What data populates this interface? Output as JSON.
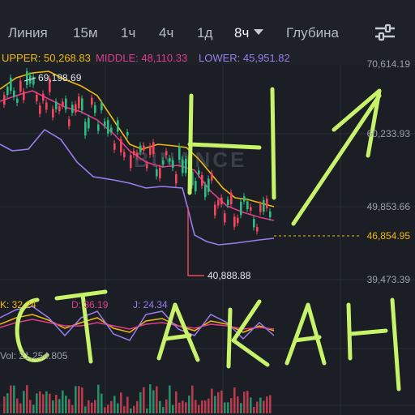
{
  "tabs": [
    {
      "label": "Линия"
    },
    {
      "label": "15м"
    },
    {
      "label": "1ч"
    },
    {
      "label": "4ч"
    },
    {
      "label": "1д"
    },
    {
      "label": "8ч",
      "active": true
    },
    {
      "label": "Глубина"
    }
  ],
  "settings_icon": "sliders-icon",
  "indicator": {
    "upper": "UPPER: 50,268.83",
    "middle": "MIDDLE: 48,110.33",
    "lower": "LOWER: 45,951.82",
    "colors": {
      "upper": "#f0b90b",
      "middle": "#e13c8c",
      "lower": "#9a7cf0"
    }
  },
  "price_axis": [
    "70,614.19",
    "60,233.93",
    "49,853.66",
    "39,473.39"
  ],
  "current_price": "46,854.95",
  "high_label": "69,198.69",
  "low_label": "40,888.88",
  "watermark": "BINANCE",
  "kdj": {
    "k": "K: 32.24",
    "d": "D: 36.19",
    "j": "J: 24.34"
  },
  "volume": "Vol: 21,254.805",
  "handwriting": [
    "Н",
    "СТАКАН"
  ],
  "colors": {
    "up": "#2ebd85",
    "down": "#f6465d",
    "ink": "#c8f26a",
    "accent": "#f0b90b"
  }
}
